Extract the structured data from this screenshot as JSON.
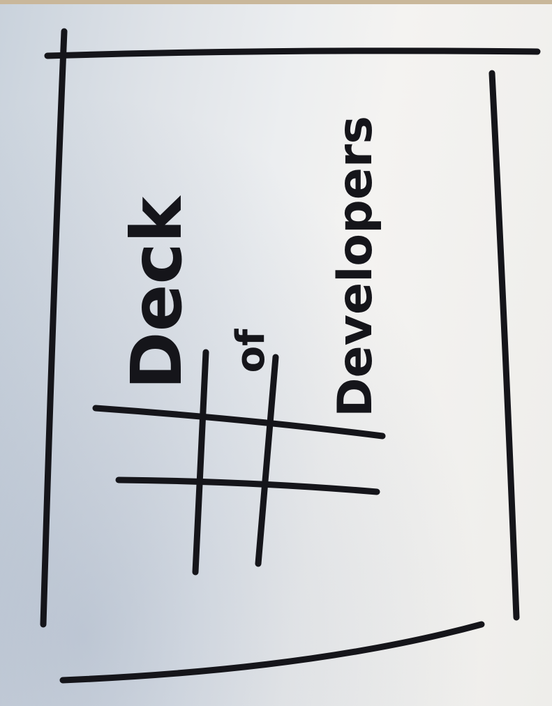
{
  "sketch": {
    "title_line1": "Deck",
    "title_line2": "of",
    "title_line3": "Developers",
    "ink_color": "#15151a"
  }
}
